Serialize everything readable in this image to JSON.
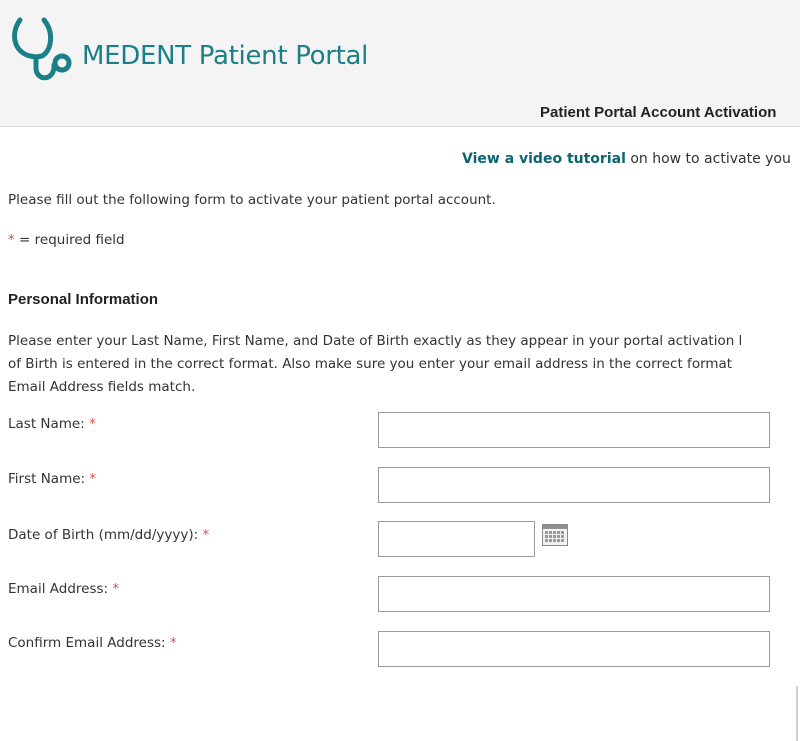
{
  "header": {
    "brand": "MEDENT Patient Portal",
    "subtitle": "Patient Portal Account Activation",
    "logo_icon": "stethoscope-icon",
    "brand_color": "#1a7f86"
  },
  "video": {
    "link_text": "View a video tutorial",
    "rest_text": " on how to activate you"
  },
  "intro": "Please fill out the following form to activate your patient portal account.",
  "required_note": {
    "star": "*",
    "text": " = required field"
  },
  "personal": {
    "title": "Personal Information",
    "instructions": [
      "Please enter your Last Name, First Name, and Date of Birth exactly as they appear in your portal activation l",
      "of Birth is entered in the correct format. Also make sure you enter your email address in the correct format",
      "Email Address fields match."
    ]
  },
  "form": {
    "required_star": "*",
    "last_name": {
      "label": "Last Name:",
      "value": ""
    },
    "first_name": {
      "label": "First Name:",
      "value": ""
    },
    "dob": {
      "label": "Date of Birth (mm/dd/yyyy):",
      "value": "",
      "icon": "calendar-icon"
    },
    "email": {
      "label": "Email Address:",
      "value": ""
    },
    "confirm_email": {
      "label": "Confirm Email Address:",
      "value": ""
    }
  },
  "colors": {
    "accent": "#1a7f86",
    "link": "#0b6470",
    "required": "#d9534f",
    "header_bg": "#f4f4f4"
  }
}
